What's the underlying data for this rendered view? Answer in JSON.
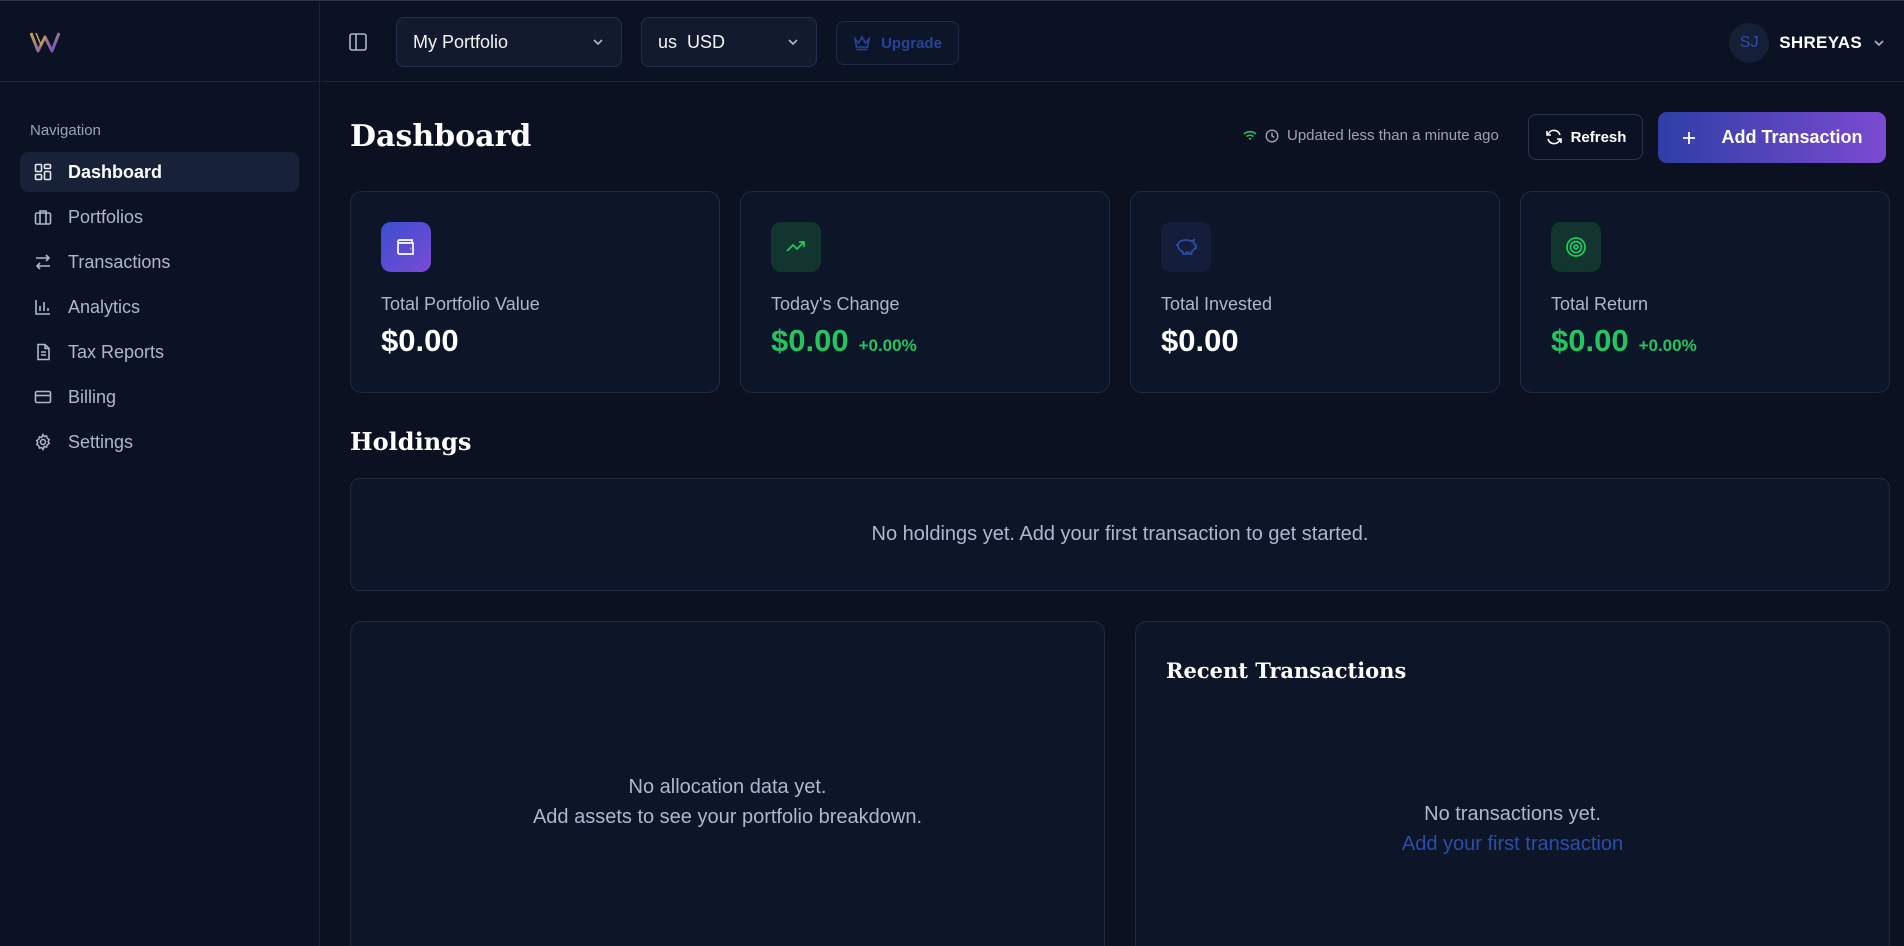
{
  "colors": {
    "background": "#0b1120",
    "accent_blue": "#2f3ea6",
    "accent_purple": "#7b4bd0",
    "positive": "#22c55e",
    "link": "#2c4da8"
  },
  "sidebar": {
    "logo_icon": "w-logo",
    "heading": "Navigation",
    "items": [
      {
        "label": "Dashboard",
        "icon": "dashboard-icon",
        "active": true
      },
      {
        "label": "Portfolios",
        "icon": "briefcase-icon"
      },
      {
        "label": "Transactions",
        "icon": "arrows-icon"
      },
      {
        "label": "Analytics",
        "icon": "bar-chart-icon"
      },
      {
        "label": "Tax Reports",
        "icon": "document-icon"
      },
      {
        "label": "Billing",
        "icon": "credit-card-icon"
      },
      {
        "label": "Settings",
        "icon": "gear-icon"
      }
    ]
  },
  "topbar": {
    "portfolio_select": "My Portfolio",
    "currency_select": "us  USD",
    "upgrade_label": "Upgrade",
    "user_initials": "SJ",
    "user_name": "SHREYAS"
  },
  "main": {
    "title": "Dashboard",
    "updated_text": "Updated less than a minute ago",
    "refresh_label": "Refresh",
    "add_transaction_label": "Add Transaction",
    "stats": [
      {
        "label": "Total Portfolio Value",
        "value": "$0.00",
        "icon": "wallet-icon"
      },
      {
        "label": "Today's Change",
        "value": "$0.00",
        "change": "+0.00%",
        "icon": "trending-up-icon"
      },
      {
        "label": "Total Invested",
        "value": "$0.00",
        "icon": "piggy-bank-icon"
      },
      {
        "label": "Total Return",
        "value": "$0.00",
        "change": "+0.00%",
        "icon": "target-icon"
      }
    ],
    "holdings_title": "Holdings",
    "holdings_empty": "No holdings yet. Add your first transaction to get started.",
    "allocation_empty_line1": "No allocation data yet.",
    "allocation_empty_line2": "Add assets to see your portfolio breakdown.",
    "recent_title": "Recent Transactions",
    "recent_empty": "No transactions yet.",
    "recent_link": "Add your first transaction"
  }
}
